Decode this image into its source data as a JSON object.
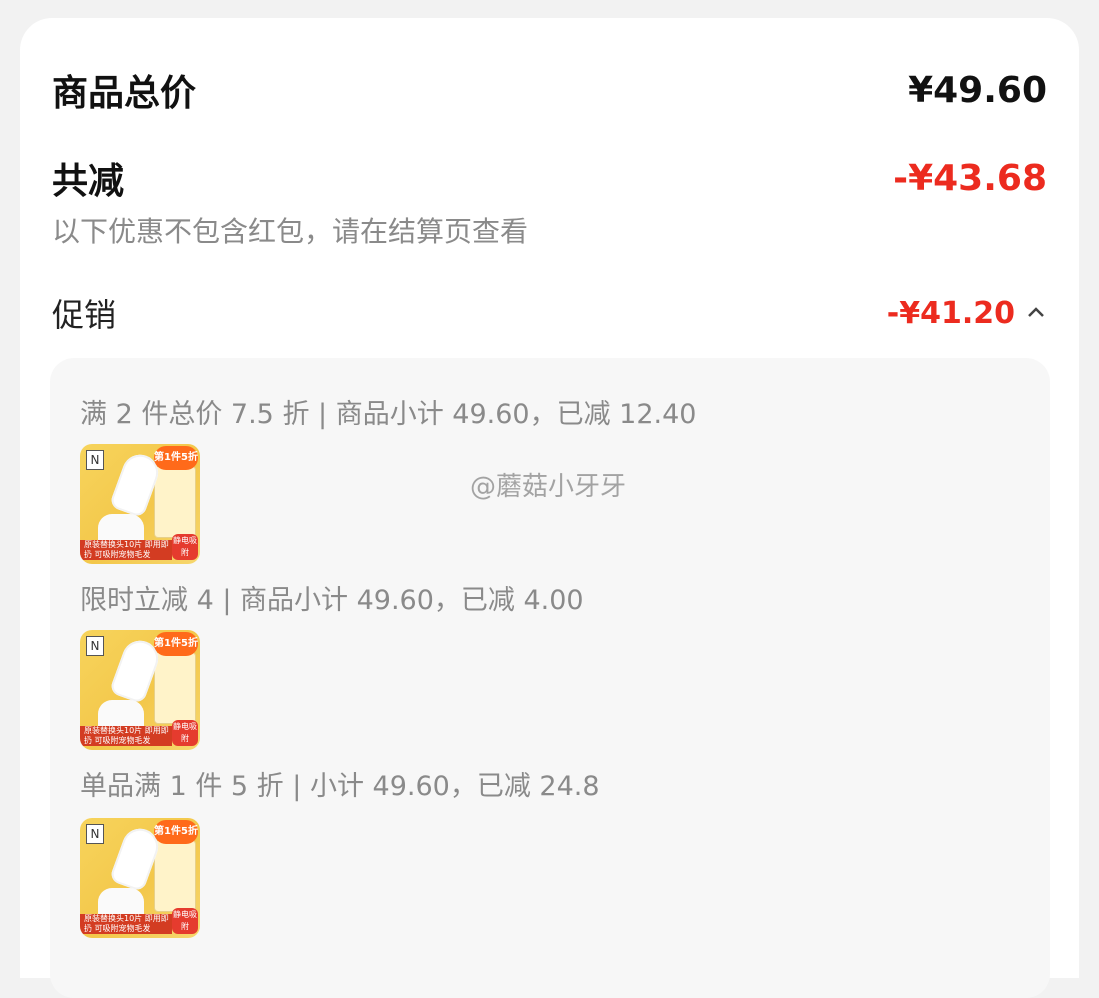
{
  "summary": {
    "total_label": "商品总价",
    "total_value": "¥49.60",
    "discount_label": "共减",
    "discount_value": "-¥43.68",
    "note": "以下优惠不包含红包，请在结算页查看"
  },
  "promotion": {
    "label": "促销",
    "value": "-¥41.20",
    "expand_icon": "chevron-up-icon",
    "items": [
      {
        "text": "满 2 件总价 7.5 折 | 商品小计 49.60，已减 12.40"
      },
      {
        "text": "限时立减 4 | 商品小计 49.60，已减 4.00"
      },
      {
        "text": "单品满 1 件 5 折 | 小计 49.60，已减 24.8"
      }
    ],
    "thumb": {
      "logo": "N",
      "badge_top": "第1件5折",
      "badge_bottom": "静电吸附",
      "strip": "原装替换头10片 即用即扔 可吸附宠物毛发"
    }
  },
  "watermark": "@蘑菇小牙牙",
  "colors": {
    "red": "#ec2b1f",
    "panel": "#f7f7f7",
    "bg": "#f2f2f2"
  }
}
